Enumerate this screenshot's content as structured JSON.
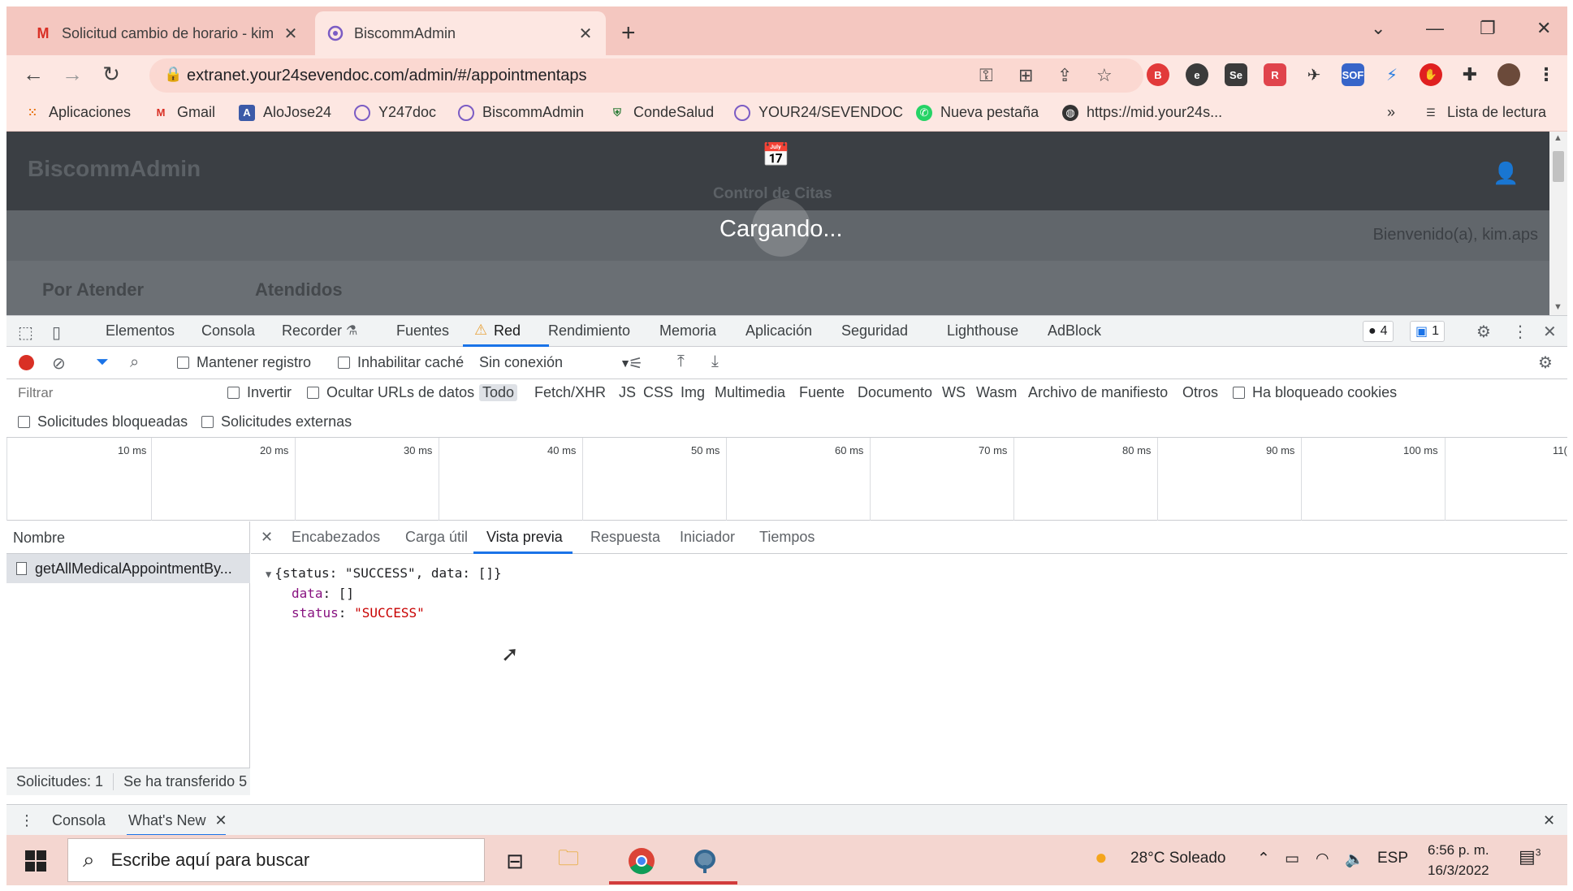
{
  "browser": {
    "tabs": [
      {
        "title": "Solicitud cambio de horario - kim",
        "icon": "gmail-icon",
        "active": false
      },
      {
        "title": "BiscommAdmin",
        "icon": "biscomm-icon",
        "active": true
      }
    ],
    "new_tab": "+",
    "url": "extranet.your24sevendoc.com/admin/#/appointmentaps",
    "bookmarks": [
      "Aplicaciones",
      "Gmail",
      "AloJose24",
      "Y247doc",
      "BiscommAdmin",
      "CondeSalud",
      "YOUR24/SEVENDOC",
      "Nueva pestaña",
      "https://mid.your24s..."
    ],
    "bookmarks_more": "»",
    "reading_list": "Lista de lectura"
  },
  "page": {
    "brand": "BiscommAdmin",
    "section_title": "Control de Citas",
    "loading": "Cargando...",
    "welcome": "Bienvenido(a), kim.aps",
    "tabs": [
      "Por Atender",
      "Atendidos"
    ]
  },
  "devtools": {
    "tabs": [
      "Elementos",
      "Consola",
      "Recorder",
      "Fuentes",
      "Red",
      "Rendimiento",
      "Memoria",
      "Aplicación",
      "Seguridad",
      "Lighthouse",
      "AdBlock"
    ],
    "active_tab": "Red",
    "error_count": "4",
    "message_count": "1",
    "network_toolbar": {
      "preserve_log": "Mantener registro",
      "disable_cache": "Inhabilitar caché",
      "throttling": "Sin conexión"
    },
    "filter": {
      "placeholder": "Filtrar",
      "invert": "Invertir",
      "hide_data_urls": "Ocultar URLs de datos",
      "types": [
        "Todo",
        "Fetch/XHR",
        "JS",
        "CSS",
        "Img",
        "Multimedia",
        "Fuente",
        "Documento",
        "WS",
        "Wasm",
        "Archivo de manifiesto",
        "Otros"
      ],
      "selected_type": "Todo",
      "blocked_cookies": "Ha bloqueado cookies",
      "blocked_requests": "Solicitudes bloqueadas",
      "third_party": "Solicitudes externas"
    },
    "timeline_labels": [
      "10 ms",
      "20 ms",
      "30 ms",
      "40 ms",
      "50 ms",
      "60 ms",
      "70 ms",
      "80 ms",
      "90 ms",
      "100 ms",
      "11("
    ],
    "name_header": "Nombre",
    "request_name": "getAllMedicalAppointmentBy...",
    "status": {
      "requests": "Solicitudes: 1",
      "transferred": "Se ha transferido 5"
    },
    "detail_tabs": [
      "Encabezados",
      "Carga útil",
      "Vista previa",
      "Respuesta",
      "Iniciador",
      "Tiempos"
    ],
    "active_detail_tab": "Vista previa",
    "preview": {
      "summary": "{status: \"SUCCESS\", data: []}",
      "data_key": "data",
      "data_value": "[]",
      "status_key": "status",
      "status_value": "\"SUCCESS\""
    },
    "drawer_tabs": [
      "Consola",
      "What's New"
    ]
  },
  "taskbar": {
    "search_placeholder": "Escribe aquí para buscar",
    "weather": "28°C  Soleado",
    "language": "ESP",
    "time": "6:56 p. m.",
    "date": "16/3/2022",
    "notifications": "3"
  },
  "colors": {
    "tab_strip": "#f4c7c0",
    "toolbar": "#fde7e2",
    "accent": "#1a73e8",
    "record": "#d93025"
  }
}
